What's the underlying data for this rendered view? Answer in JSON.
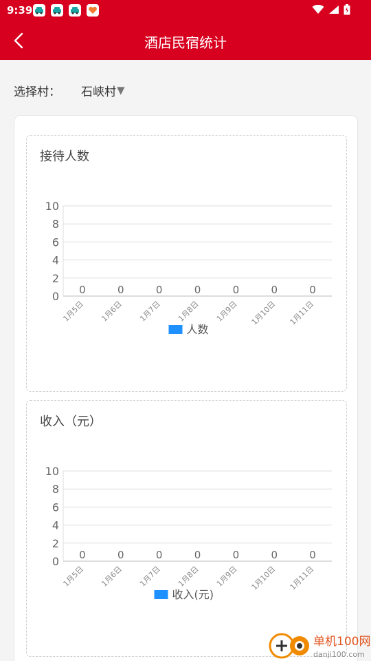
{
  "status_bar": {
    "time": "9:39"
  },
  "header": {
    "title": "酒店民宿统计",
    "back_icon": "chevron-left-icon"
  },
  "filter": {
    "label": "选择村：",
    "selected_village": "石峡村",
    "arrow": "▼"
  },
  "colors": {
    "brand": "#d7001e",
    "series": "#1e90ff"
  },
  "charts": [
    {
      "title": "接待人数",
      "legend": "人数"
    },
    {
      "title": "收入（元）",
      "legend": "收入(元)"
    }
  ],
  "chart_data": [
    {
      "type": "bar",
      "title": "接待人数",
      "categories": [
        "1月5日",
        "1月6日",
        "1月7日",
        "1月8日",
        "1月9日",
        "1月10日",
        "1月11日"
      ],
      "series": [
        {
          "name": "人数",
          "values": [
            0,
            0,
            0,
            0,
            0,
            0,
            0
          ]
        }
      ],
      "yticks": [
        0,
        2,
        4,
        6,
        8,
        10
      ],
      "ylim": [
        0,
        10
      ],
      "grid": true,
      "legend_position": "bottom-center",
      "data_labels": [
        "0",
        "0",
        "0",
        "0",
        "0",
        "0",
        "0"
      ]
    },
    {
      "type": "bar",
      "title": "收入（元）",
      "categories": [
        "1月5日",
        "1月6日",
        "1月7日",
        "1月8日",
        "1月9日",
        "1月10日",
        "1月11日"
      ],
      "series": [
        {
          "name": "收入(元)",
          "values": [
            0,
            0,
            0,
            0,
            0,
            0,
            0
          ]
        }
      ],
      "yticks": [
        0,
        2,
        4,
        6,
        8,
        10
      ],
      "ylim": [
        0,
        10
      ],
      "grid": true,
      "legend_position": "bottom-center",
      "data_labels": [
        "0",
        "0",
        "0",
        "0",
        "0",
        "0",
        "0"
      ]
    }
  ],
  "watermark": {
    "text_cn": "单机100网",
    "text_url": "danji100.com"
  }
}
